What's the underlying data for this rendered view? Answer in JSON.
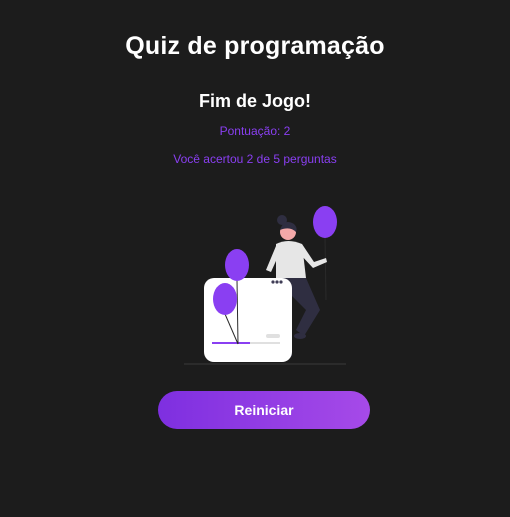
{
  "app": {
    "title": "Quiz de programação"
  },
  "result": {
    "heading": "Fim de Jogo!",
    "score_text": "Pontuação: 2",
    "summary_text": "Você acertou 2 de 5 perguntas"
  },
  "actions": {
    "restart_label": "Reiniciar"
  },
  "colors": {
    "accent": "#8a3ff2",
    "background": "#1c1c1c",
    "button_start": "#7e2fe0",
    "button_end": "#a64ae8"
  },
  "illustration": {
    "name": "woman-with-balloons-illustration"
  }
}
